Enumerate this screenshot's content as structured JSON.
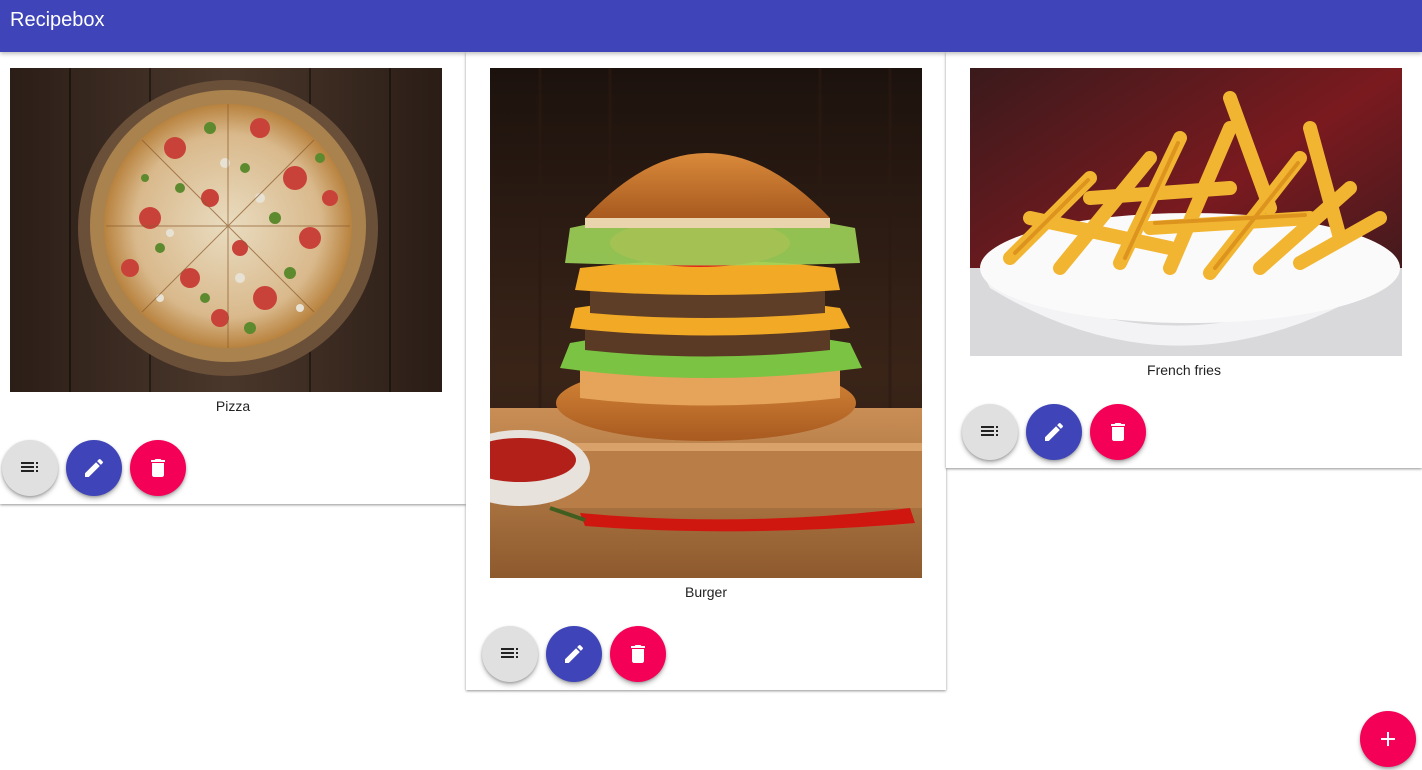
{
  "appbar": {
    "title": "Recipebox",
    "color": "#3f45b8"
  },
  "recipes": [
    {
      "name": "Pizza",
      "image_icon": "pizza-photo"
    },
    {
      "name": "Burger",
      "image_icon": "burger-photo"
    },
    {
      "name": "French fries",
      "image_icon": "fries-photo"
    }
  ],
  "actions": {
    "view_icon": "list-icon",
    "edit_icon": "pencil-icon",
    "delete_icon": "trash-icon",
    "add_icon": "plus-icon"
  },
  "colors": {
    "primary": "#3f45b8",
    "accent": "#f50057",
    "neutral": "#e0e0e0"
  }
}
